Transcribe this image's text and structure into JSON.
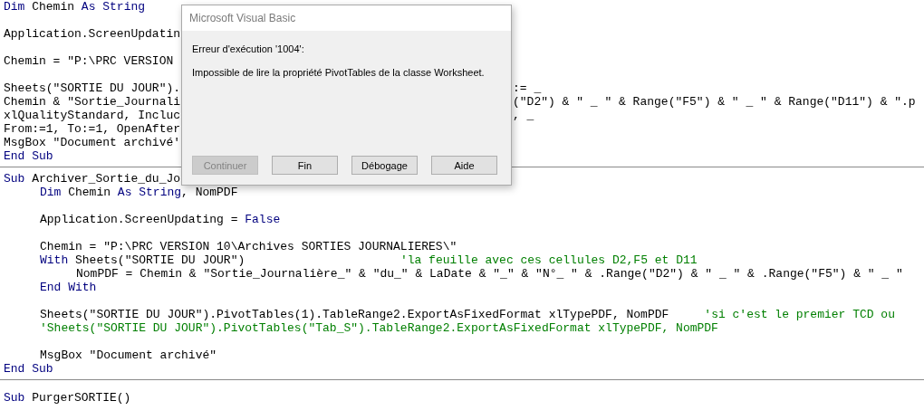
{
  "editor": {
    "procedures": [
      {
        "blocks": [
          [
            {
              "left": [
                {
                  "kind": "keyword",
                  "text": "Dim"
                },
                {
                  "kind": "plain",
                  "text": " Chemin "
                },
                {
                  "kind": "keyword",
                  "text": "As String"
                }
              ]
            }
          ],
          [
            {
              "left": [
                {
                  "kind": "plain",
                  "text": "Application.ScreenUpdatin"
                }
              ]
            }
          ],
          [
            {
              "left": [
                {
                  "kind": "plain",
                  "text": "Chemin = \"P:\\PRC VERSION"
                }
              ]
            }
          ],
          [
            {
              "left": [
                {
                  "kind": "plain",
                  "text": "Sheets(\"SORTIE DU JOUR\")."
                }
              ],
              "right": [
                {
                  "kind": "plain",
                  "text": ":= _"
                }
              ]
            },
            {
              "left": [
                {
                  "kind": "plain",
                  "text": "Chemin & \"Sortie_Journali"
                }
              ],
              "right": [
                {
                  "kind": "plain",
                  "text": "(\"D2\") & \" _ \" & Range(\"F5\") & \" _ \" & Range(\"D11\") & \".p"
                }
              ]
            },
            {
              "left": [
                {
                  "kind": "plain",
                  "text": "xlQualityStandard, Incluc"
                }
              ],
              "right": [
                {
                  "kind": "plain",
                  "text": ", _"
                }
              ]
            },
            {
              "left": [
                {
                  "kind": "plain",
                  "text": "From:=1, To:=1, OpenAfter"
                }
              ]
            },
            {
              "left": [
                {
                  "kind": "plain",
                  "text": "MsgBox \"Document archivé'"
                }
              ]
            },
            {
              "left": [
                {
                  "kind": "keyword",
                  "text": "End Sub"
                }
              ]
            }
          ]
        ]
      },
      {
        "blocks": [
          [
            {
              "left": [
                {
                  "kind": "keyword",
                  "text": "Sub"
                },
                {
                  "kind": "plain",
                  "text": " Archiver_Sortie_du_Jo"
                }
              ],
              "children": [
                [
                  {
                    "left": [
                      {
                        "kind": "keyword",
                        "text": "Dim"
                      },
                      {
                        "kind": "plain",
                        "text": " Chemin "
                      },
                      {
                        "kind": "keyword",
                        "text": "As String"
                      },
                      {
                        "kind": "plain",
                        "text": ", NomPDF"
                      }
                    ]
                  }
                ],
                [
                  {
                    "left": [
                      {
                        "kind": "plain",
                        "text": "Application.ScreenUpdating = "
                      },
                      {
                        "kind": "keyword",
                        "text": "False"
                      }
                    ]
                  }
                ],
                [
                  {
                    "left": [
                      {
                        "kind": "plain",
                        "text": "Chemin = \"P:\\PRC VERSION 10\\Archives SORTIES JOURNALIERES\\\""
                      }
                    ]
                  },
                  {
                    "left": [
                      {
                        "kind": "keyword",
                        "text": "With"
                      },
                      {
                        "kind": "plain",
                        "text": " Sheets(\"SORTIE DU JOUR\")                      "
                      },
                      {
                        "kind": "comment",
                        "text": "'la feuille avec ces cellules D2,F5 et D11"
                      }
                    ],
                    "children": [
                      [
                        {
                          "left": [
                            {
                              "kind": "plain",
                              "text": "NomPDF = Chemin & \"Sortie_Journalière_\" & \"du_\" & LaDate & \"_\" & \"N°_ \" & .Range(\"D2\") & \" _ \" & .Range(\"F5\") & \" _ \""
                            }
                          ]
                        }
                      ]
                    ]
                  },
                  {
                    "left": [
                      {
                        "kind": "keyword",
                        "text": "End With"
                      }
                    ]
                  }
                ],
                [
                  {
                    "left": [
                      {
                        "kind": "plain",
                        "text": "Sheets(\"SORTIE DU JOUR\").PivotTables(1).TableRange2.ExportAsFixedFormat xlTypePDF, NomPDF     "
                      },
                      {
                        "kind": "comment",
                        "text": "'si c'est le premier TCD ou"
                      }
                    ]
                  },
                  {
                    "left": [
                      {
                        "kind": "comment",
                        "text": "'Sheets(\"SORTIE DU JOUR\").PivotTables(\"Tab_S\").TableRange2.ExportAsFixedFormat xlTypePDF, NomPDF"
                      }
                    ]
                  }
                ],
                [
                  {
                    "left": [
                      {
                        "kind": "plain",
                        "text": "MsgBox \"Document archivé\""
                      }
                    ]
                  }
                ]
              ]
            },
            {
              "left": [
                {
                  "kind": "keyword",
                  "text": "End Sub"
                }
              ]
            }
          ]
        ]
      },
      {
        "blocks": [
          [
            {
              "left": [
                {
                  "kind": "keyword",
                  "text": "Sub"
                },
                {
                  "kind": "plain",
                  "text": " PurgerSORTIE()"
                }
              ]
            }
          ]
        ]
      }
    ]
  },
  "dialog": {
    "title": "Microsoft Visual Basic",
    "message_lines": [
      "Erreur d'exécution '1004':",
      "Impossible de lire la propriété PivotTables de la classe Worksheet."
    ],
    "buttons": [
      {
        "label": "Continuer",
        "disabled": true
      },
      {
        "label": "Fin",
        "disabled": false
      },
      {
        "label": "Débogage",
        "disabled": false
      },
      {
        "label": "Aide",
        "disabled": false
      }
    ]
  }
}
